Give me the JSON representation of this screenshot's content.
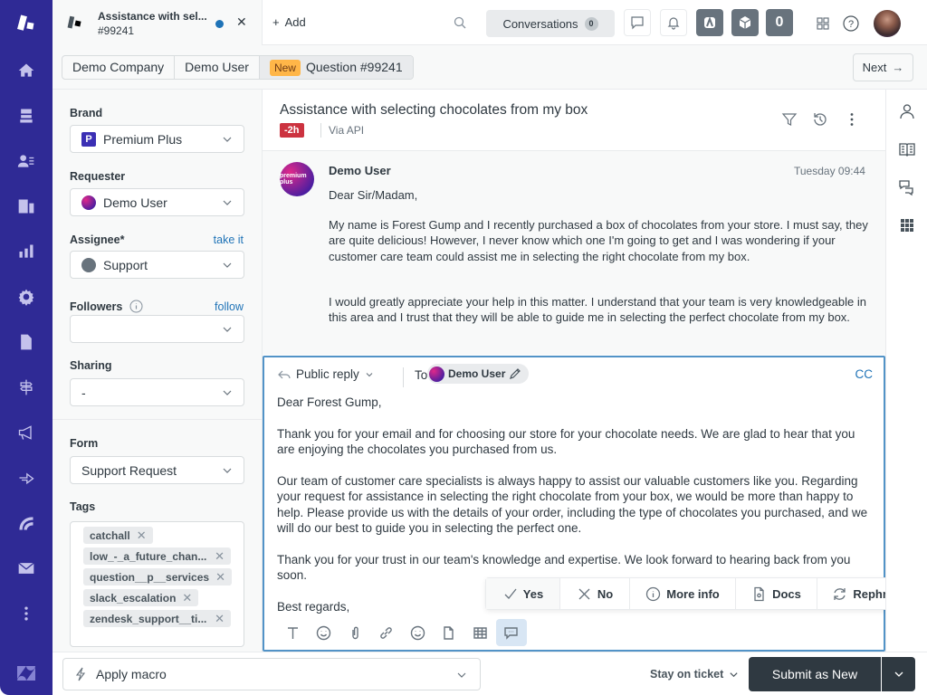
{
  "tab": {
    "title": "Assistance with sel...",
    "ticket_id": "#99241"
  },
  "topbar": {
    "add_label": "Add",
    "conversations_label": "Conversations",
    "conversations_count": "0",
    "counter_badge": "0"
  },
  "breadcrumb": {
    "organization": "Demo Company",
    "requester": "Demo User",
    "status_badge": "New",
    "ticket": "Question #99241",
    "next_label": "Next"
  },
  "sidebar": {
    "brand_label": "Brand",
    "brand_value": "Premium Plus",
    "requester_label": "Requester",
    "requester_value": "Demo User",
    "assignee_label": "Assignee*",
    "assignee_link": "take it",
    "assignee_value": "Support",
    "followers_label": "Followers",
    "followers_link": "follow",
    "followers_value": "",
    "sharing_label": "Sharing",
    "sharing_value": "-",
    "form_label": "Form",
    "form_value": "Support Request",
    "tags_label": "Tags",
    "tags": [
      "catchall",
      "low_-_a_future_chan...",
      "question__p__services",
      "slack_escalation",
      "zendesk_support__ti..."
    ]
  },
  "ticket": {
    "subject": "Assistance with selecting chocolates from my box",
    "sla_badge": "-2h",
    "channel": "Via API"
  },
  "message": {
    "author": "Demo User",
    "avatar_text": "premium plus",
    "timestamp": "Tuesday 09:44",
    "greeting": "Dear Sir/Madam,",
    "paragraphs": [
      "My name is Forest Gump and I recently purchased a box of chocolates from your store. I must say, they are quite delicious! However, I never know which one I'm going to get and I was wondering if your customer care team could assist me in selecting the right chocolate from my box.",
      "I would greatly appreciate your help in this matter. I understand that your team is very knowledgeable in this area and I trust that they will be able to guide me in selecting the perfect chocolate from my box."
    ]
  },
  "editor": {
    "reply_type": "Public reply",
    "to_label": "To",
    "to_recipient": "Demo User",
    "cc_label": "CC",
    "body": [
      "Dear Forest Gump,",
      "Thank you for your email and for choosing our store for your chocolate needs. We are glad to hear that you are enjoying the chocolates you purchased from us.",
      "Our team of customer care specialists is always happy to assist our valuable customers like you. Regarding your request for assistance in selecting the right chocolate from your box, we would be more than happy to help. Please provide us with the details of your order, including the type of chocolates you purchased, and we will do our best to guide you in selecting the perfect one.",
      "Thank you for your trust in our team's knowledge and expertise. We look forward to hearing back from you soon.",
      "Best regards,"
    ]
  },
  "ai_suggestions": {
    "yes": "Yes",
    "no": "No",
    "more_info": "More info",
    "docs": "Docs",
    "rephrase": "Rephrase"
  },
  "footer": {
    "macro_placeholder": "Apply macro",
    "stay_label": "Stay on ticket",
    "submit_label": "Submit as New"
  }
}
